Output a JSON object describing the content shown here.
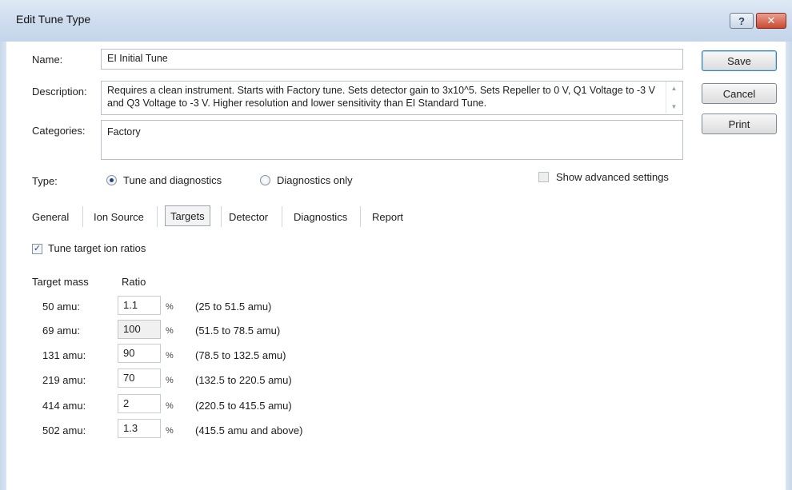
{
  "window": {
    "title": "Edit Tune Type",
    "help_glyph": "?",
    "close_glyph": "✕"
  },
  "form": {
    "name_label": "Name:",
    "name_value": "EI Initial Tune",
    "description_label": "Description:",
    "description_value": "Requires a clean instrument. Starts with Factory tune. Sets detector gain to 3x10^5. Sets Repeller to 0 V, Q1 Voltage to -3 V and Q3 Voltage to -3 V. Higher resolution and lower sensitivity than EI Standard Tune.",
    "categories_label": "Categories:",
    "categories_value": "Factory",
    "type_label": "Type:",
    "type_options": [
      {
        "label": "Tune and diagnostics",
        "selected": true
      },
      {
        "label": "Diagnostics only",
        "selected": false
      }
    ],
    "show_advanced_label": "Show advanced settings",
    "show_advanced_checked": false
  },
  "buttons": {
    "save": "Save",
    "cancel": "Cancel",
    "print": "Print"
  },
  "tabs": [
    {
      "label": "General",
      "active": false
    },
    {
      "label": "Ion Source",
      "active": false
    },
    {
      "label": "Targets",
      "active": true
    },
    {
      "label": "Detector",
      "active": false
    },
    {
      "label": "Diagnostics",
      "active": false
    },
    {
      "label": "Report",
      "active": false
    }
  ],
  "targets": {
    "tune_ratios_label": "Tune target ion ratios",
    "tune_ratios_checked": true,
    "col_mass": "Target mass",
    "col_ratio": "Ratio",
    "percent": "%",
    "rows": [
      {
        "mass": "50 amu:",
        "ratio": "1.1",
        "range": "(25 to 51.5 amu)",
        "editable": true
      },
      {
        "mass": "69 amu:",
        "ratio": "100",
        "range": "(51.5 to 78.5 amu)",
        "editable": false
      },
      {
        "mass": "131 amu:",
        "ratio": "90",
        "range": "(78.5 to 132.5 amu)",
        "editable": true
      },
      {
        "mass": "219 amu:",
        "ratio": "70",
        "range": "(132.5 to 220.5 amu)",
        "editable": true
      },
      {
        "mass": "414 amu:",
        "ratio": "2",
        "range": "(220.5 to 415.5 amu)",
        "editable": true
      },
      {
        "mass": "502 amu:",
        "ratio": "1.3",
        "range": "(415.5 amu and above)",
        "editable": true
      }
    ]
  },
  "colors": {
    "title_bar": "#cddcee",
    "close_button": "#c84a30",
    "default_button_border": "#3c7fb1"
  }
}
